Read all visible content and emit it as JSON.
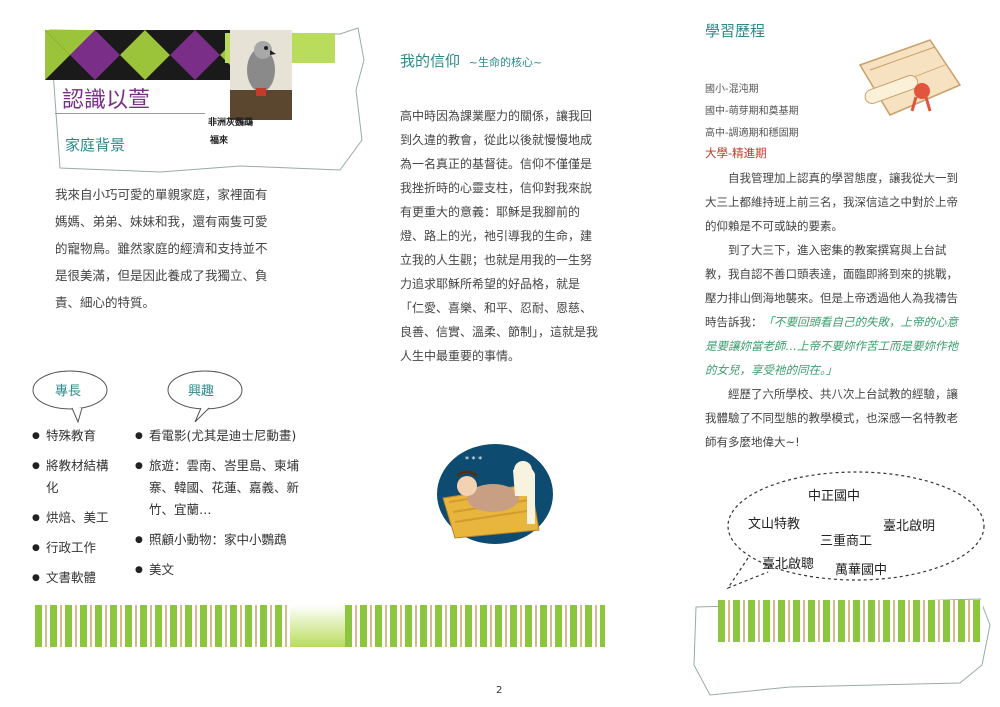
{
  "left": {
    "title": "認識以萱",
    "photo_caption_1": "非洲灰鸚鵡",
    "photo_caption_2": "福來",
    "family_heading": "家庭背景",
    "family_text": "我來自小巧可愛的單親家庭，家裡面有媽媽、弟弟、妹妹和我，還有兩隻可愛的寵物鳥。雖然家庭的經濟和支持並不是很美滿，但是因此養成了我獨立、負責、細心的特質。",
    "skills_label": "專長",
    "interests_label": "興趣",
    "skills": [
      "特殊教育",
      "將教材結構化",
      "烘焙、美工",
      "行政工作",
      "文書軟體"
    ],
    "interests": [
      "看電影(尤其是迪士尼動畫)",
      "旅遊：雲南、峇里島、柬埔寨、韓國、花蓮、嘉義、新竹、宜蘭…",
      "照顧小動物：家中小鸚鵡",
      "美文"
    ]
  },
  "middle": {
    "heading": "我的信仰",
    "heading_sub": "~生命的核心~",
    "text": "高中時因為課業壓力的關係，讓我回到久違的教會，從此以後就慢慢地成為一名真正的基督徒。信仰不僅僅是我挫折時的心靈支柱，信仰對我來說有更重大的意義：耶穌是我腳前的燈、路上的光，祂引導我的生命，建立我的人生觀；也就是用我的一生努力追求耶穌所希望的好品格，就是「仁愛、喜樂、和平、忍耐、恩慈、良善、信實、溫柔、節制」，這就是我人生中最重要的事情。"
  },
  "right": {
    "heading": "學習歷程",
    "stages": [
      "國小-混沌期",
      "國中-萌芽期和奠基期",
      "高中-調適期和穩固期"
    ],
    "college_stage": "大學-精進期",
    "para1": "自我管理加上認真的學習態度，讓我從大一到大三上都維持班上前三名，我深信這之中對於上帝的仰賴是不可或缺的要素。",
    "para2": "到了大三下，進入密集的教案撰寫與上台試教，我自認不善口頭表達，面臨即將到來的挑戰，壓力排山倒海地襲來。但是上帝透過他人為我禱告時告訴我：",
    "quote": "「不要回頭看自己的失敗，上帝的心意是要讓妳當老師…上帝不要妳作苦工而是要妳作祂的女兒，享受祂的同在。」",
    "para3": "經歷了六所學校、共八次上台試教的經驗，讓我體驗了不同型態的教學模式，也深感一名特教老師有多麼地偉大~!",
    "schools": [
      "中正國中",
      "文山特教",
      "臺北啟明",
      "三重商工",
      "臺北啟聰",
      "萬華國中"
    ]
  },
  "page_number": "2",
  "colors": {
    "title_purple": "#7a2e88",
    "teal": "#2e8a8a",
    "green": "#8cc63f",
    "quote_green": "#3a9e6e",
    "college_red": "#c0392b"
  }
}
